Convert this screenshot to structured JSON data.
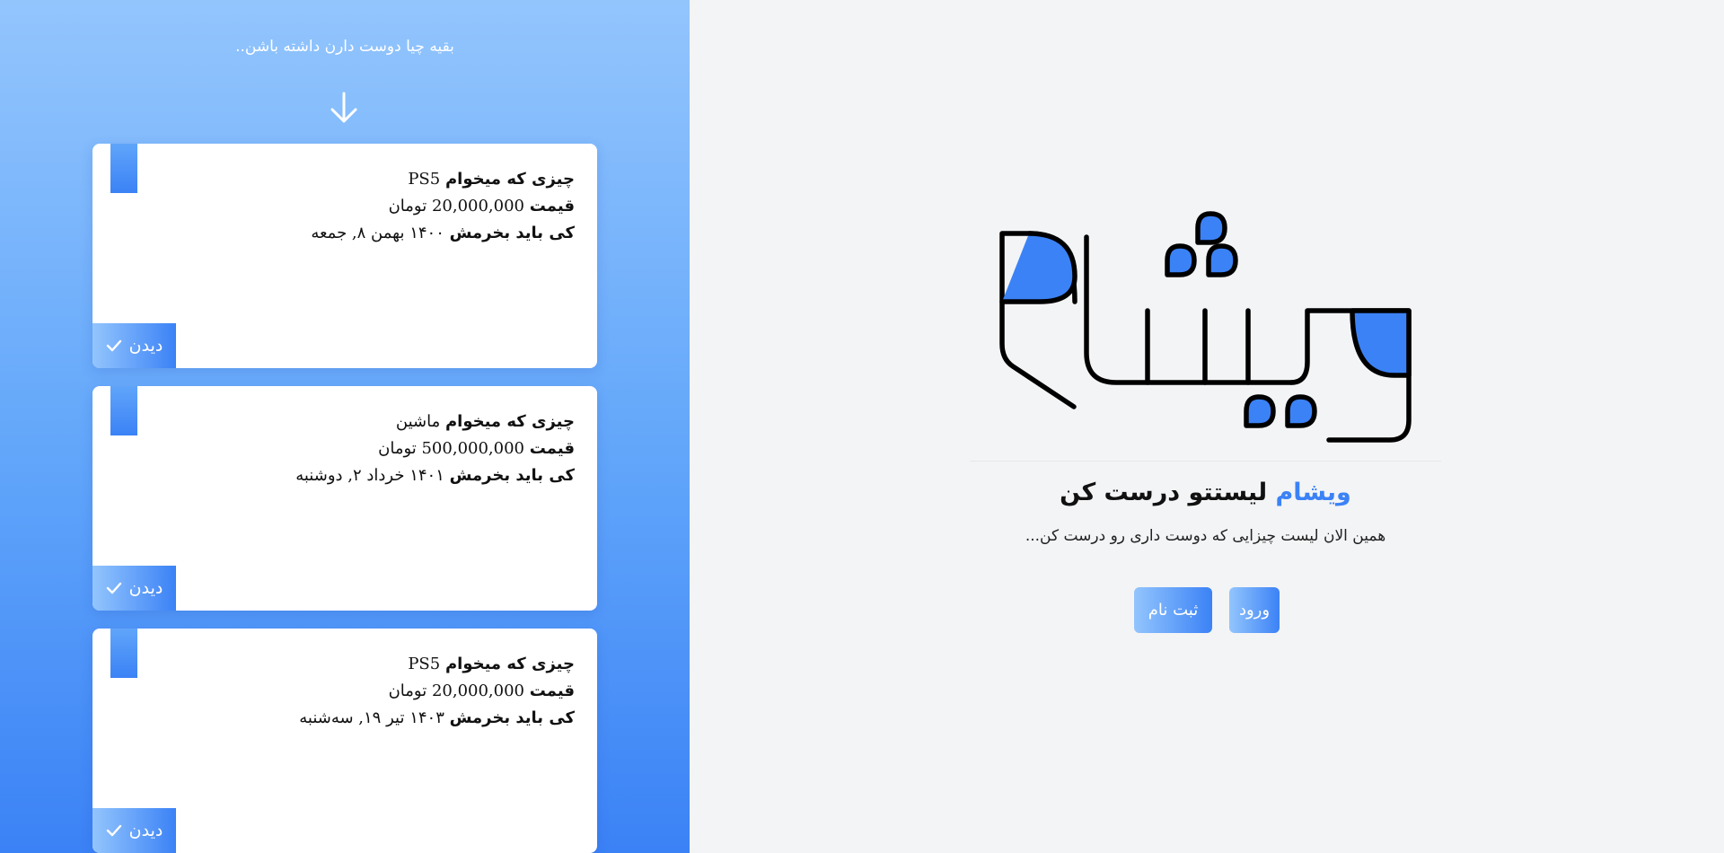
{
  "colors": {
    "accent": "#3b82f6",
    "panel_top": "#93c5fd",
    "panel_bottom": "#3b82f6",
    "background": "#f3f4f6"
  },
  "sidebar": {
    "heading": "بقیه چیا دوست دارن داشته باشن..",
    "arrow_icon": "arrow-down-icon",
    "item_label": "چیزی که میخوام",
    "price_label": "قیمت",
    "date_label": "کی باید بخرمش",
    "view_label": "دیدن",
    "view_icon": "check-icon",
    "cards": [
      {
        "item": "PS5",
        "price": "20,000,000 تومان",
        "date": "۱۴۰۰ بهمن ۸, جمعه"
      },
      {
        "item": "ماشین",
        "price": "500,000,000 تومان",
        "date": "۱۴۰۱ خرداد ۲, دوشنبه"
      },
      {
        "item": "PS5",
        "price": "20,000,000 تومان",
        "date": "۱۴۰۳ تیر ۱۹, سه‌شنبه"
      }
    ]
  },
  "hero": {
    "logo_text": "ویشام",
    "brand": "ویشام",
    "title_rest": "لیستتو درست کن",
    "subtitle": "همین الان لیست چیزایی که دوست داری رو درست کن...",
    "login_label": "ورود",
    "signup_label": "ثبت نام"
  }
}
